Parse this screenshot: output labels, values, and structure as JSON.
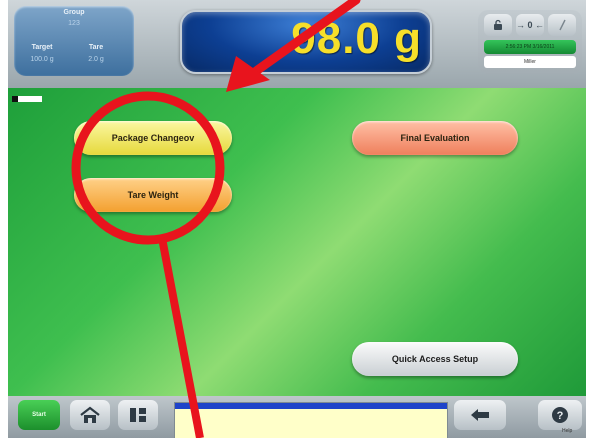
{
  "header": {
    "group_label": "Group",
    "group_value": "123",
    "target_label": "Target",
    "target_value": "100.0 g",
    "tare_label": "Tare",
    "tare_value": "2.0 g",
    "weight": "98.0 g",
    "icons": [
      "lock-icon",
      "zero-icon",
      "tare-icon"
    ],
    "zero_label": "→ 0 ←",
    "datetime": "2:56:23 PM  3/16/2011",
    "user": "Miller"
  },
  "main": {
    "package_changeover": "Package Changeov",
    "tare_weight": "Tare Weight",
    "final_evaluation": "Final Evaluation",
    "quick_access_setup": "Quick Access Setup"
  },
  "footer": {
    "start_label": "Start",
    "icons": [
      "home-icon",
      "columns-icon",
      "back-icon",
      "help-icon"
    ],
    "help_label": "Help"
  },
  "colors": {
    "weight_text": "#f6df2a",
    "main_bg": "#3fbf4f",
    "annotation": "#e8141d"
  }
}
